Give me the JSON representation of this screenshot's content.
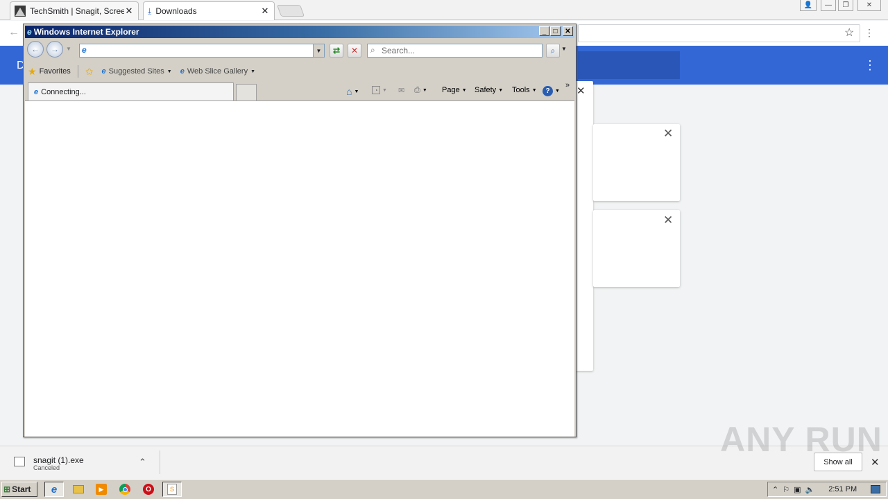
{
  "chrome": {
    "tabs": [
      {
        "title": "TechSmith | Snagit, Screen C"
      },
      {
        "title": "Downloads"
      }
    ],
    "download_shelf": {
      "file_name": "snagit (1).exe",
      "status": "Canceled",
      "show_all_label": "Show all"
    },
    "header_letter": "D"
  },
  "ie": {
    "title": "Windows Internet Explorer",
    "address_value": "",
    "search_placeholder": "Search...",
    "favorites_label": "Favorites",
    "suggested_sites_label": "Suggested Sites",
    "web_slice_label": "Web Slice Gallery",
    "tab_label": "Connecting...",
    "commands": {
      "page": "Page",
      "safety": "Safety",
      "tools": "Tools"
    },
    "more_chevron": "»"
  },
  "watermark": "ANY RUN",
  "taskbar": {
    "start_label": "Start",
    "clock": "2:51 PM"
  }
}
